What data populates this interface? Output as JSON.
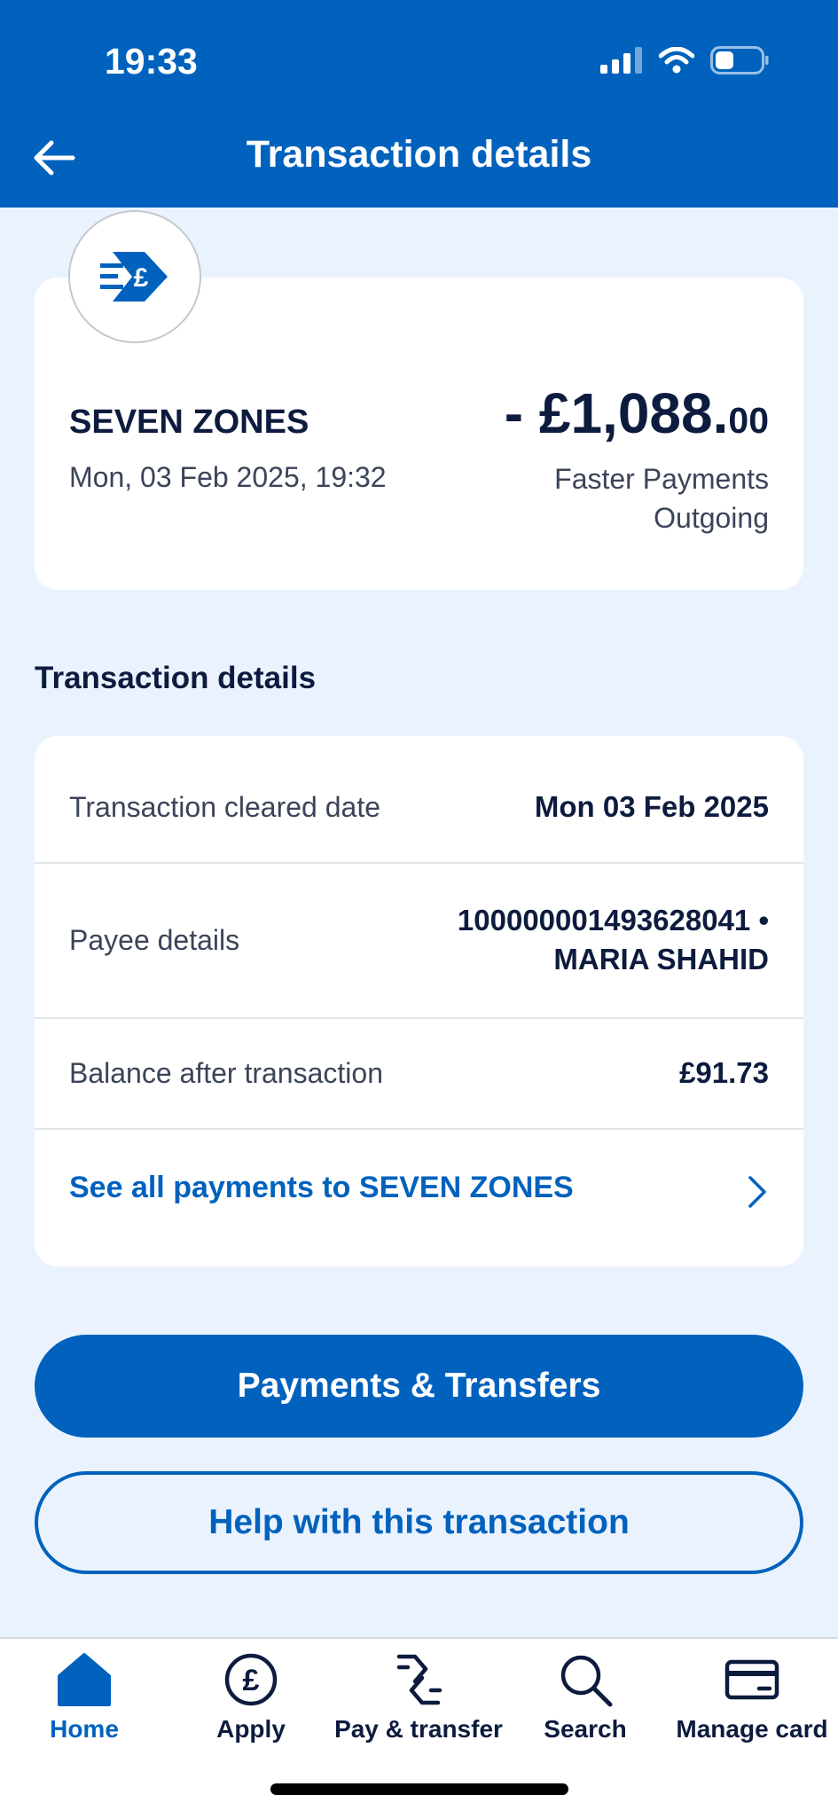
{
  "status_bar": {
    "time": "19:33"
  },
  "header": {
    "title": "Transaction details"
  },
  "summary": {
    "merchant": "SEVEN ZONES",
    "datetime": "Mon, 03 Feb 2025, 19:32",
    "amount_main": "- £1,088.",
    "amount_pence": "00",
    "type_line1": "Faster Payments",
    "type_line2": "Outgoing"
  },
  "details": {
    "section_title": "Transaction details",
    "rows": [
      {
        "label": "Transaction cleared date",
        "value": "Mon 03 Feb 2025"
      },
      {
        "label": "Payee details",
        "value_line1": "100000001493628041 •",
        "value_line2": "MARIA SHAHID"
      },
      {
        "label": "Balance after transaction",
        "value": "£91.73"
      }
    ],
    "see_all": "See all payments to SEVEN ZONES"
  },
  "buttons": {
    "primary": "Payments & Transfers",
    "secondary": "Help with this transaction"
  },
  "nav": {
    "items": [
      {
        "label": "Home",
        "icon": "home-icon",
        "active": true
      },
      {
        "label": "Apply",
        "icon": "pound-circle-icon"
      },
      {
        "label": "Pay & transfer",
        "icon": "pay-transfer-icon"
      },
      {
        "label": "Search",
        "icon": "search-icon"
      },
      {
        "label": "Manage card",
        "icon": "card-icon"
      }
    ]
  },
  "colors": {
    "brand": "#0062bd",
    "background": "#eaf3fd",
    "text": "#0d1b3e"
  }
}
